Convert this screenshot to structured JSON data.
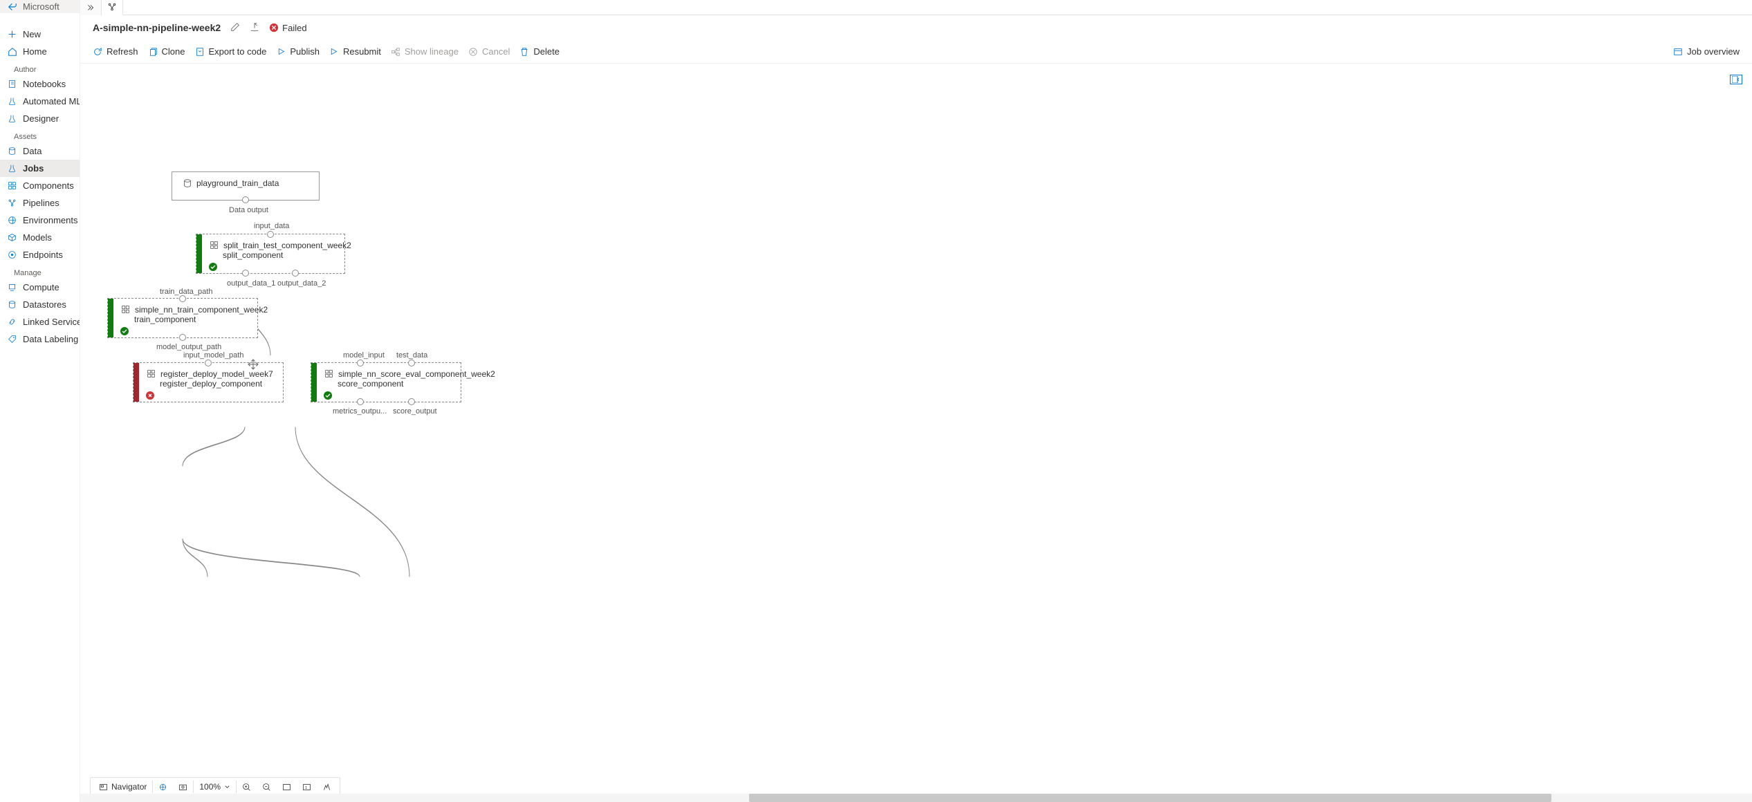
{
  "brand": "Microsoft",
  "sidebar": {
    "new": "New",
    "home": "Home",
    "sections": {
      "author": "Author",
      "assets": "Assets",
      "manage": "Manage"
    },
    "author_items": [
      "Notebooks",
      "Automated ML",
      "Designer"
    ],
    "assets_items": [
      "Data",
      "Jobs",
      "Components",
      "Pipelines",
      "Environments",
      "Models",
      "Endpoints"
    ],
    "manage_items": [
      "Compute",
      "Datastores",
      "Linked Services",
      "Data Labeling"
    ],
    "selected": "Jobs"
  },
  "header": {
    "pipeline_name": "A-simple-nn-pipeline-week2",
    "status_label": "Failed"
  },
  "toolbar": {
    "refresh": "Refresh",
    "clone": "Clone",
    "export": "Export to code",
    "publish": "Publish",
    "resubmit": "Resubmit",
    "lineage": "Show lineage",
    "cancel": "Cancel",
    "delete": "Delete",
    "overview": "Job overview"
  },
  "canvas": {
    "nodes": {
      "data": {
        "title": "playground_train_data",
        "out1": "Data output"
      },
      "split": {
        "title": "split_train_test_component_week2",
        "subtitle": "split_component",
        "in1": "input_data",
        "out1": "output_data_1",
        "out2": "output_data_2"
      },
      "train": {
        "title": "simple_nn_train_component_week2",
        "subtitle": "train_component",
        "in1": "train_data_path",
        "out1": "model_output_path"
      },
      "register": {
        "title": "register_deploy_model_week7",
        "subtitle": "register_deploy_component",
        "in1": "input_model_path"
      },
      "score": {
        "title": "simple_nn_score_eval_component_week2",
        "subtitle": "score_component",
        "in1": "model_input",
        "in2": "test_data",
        "out1": "metrics_outpu...",
        "out2": "score_output"
      }
    },
    "zoom": "100%",
    "navigator_label": "Navigator"
  }
}
